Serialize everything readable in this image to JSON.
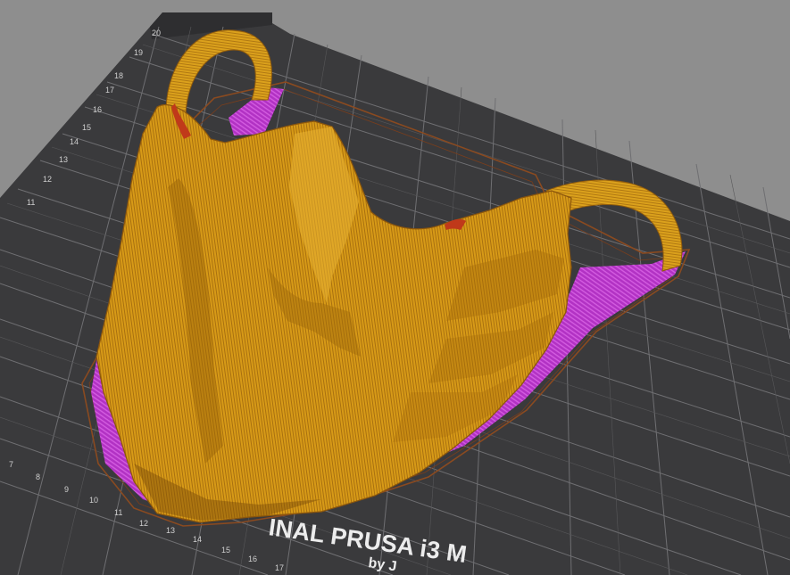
{
  "viewport": {
    "name": "3D print preview"
  },
  "bed": {
    "brand_text": "INAL PRUSA i3 M",
    "sub_text": "by J",
    "y_labels": [
      "20",
      "19",
      "18",
      "17",
      "16",
      "15",
      "14",
      "13",
      "12",
      "11"
    ],
    "x_labels": [
      "7",
      "8",
      "9",
      "10",
      "11",
      "12",
      "13",
      "14",
      "15",
      "16",
      "17"
    ]
  },
  "colors": {
    "background": "#8e8e8e",
    "bed_surface": "#3b3b3d",
    "grid_line": "#7a7a7d",
    "model_perimeter": "#d99a14",
    "support_interface": "#b536c6",
    "skirt_outline": "#8a4a20"
  },
  "object": {
    "name": "face-mask",
    "type": "sliced-print-preview"
  }
}
